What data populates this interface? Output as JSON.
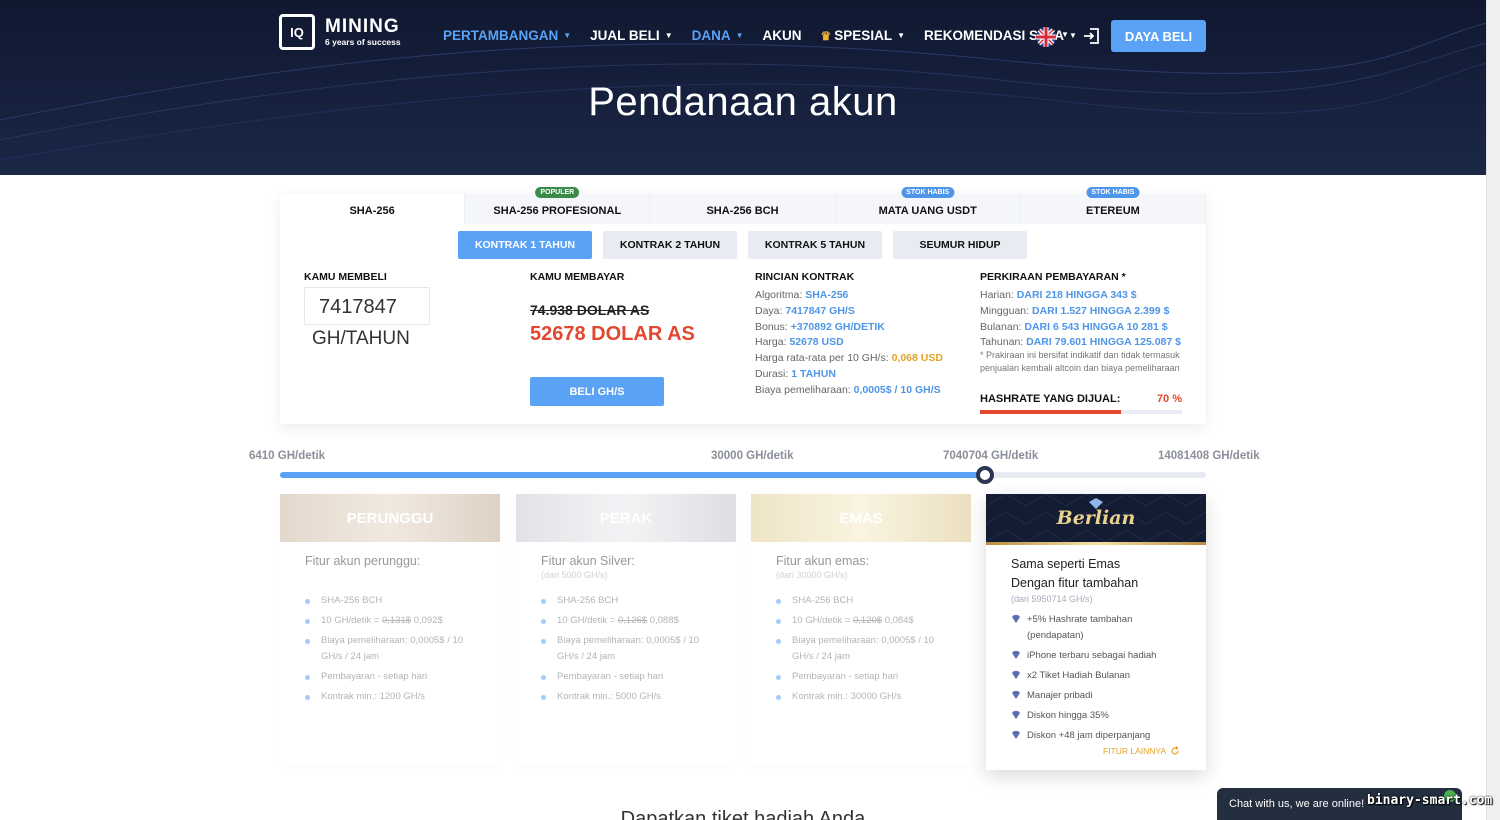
{
  "header": {
    "logo": {
      "mark": "IQ",
      "name": "MINING",
      "tagline": "6 years of success"
    },
    "nav": [
      {
        "label": "PERTAMBANGAN",
        "caret": true,
        "active": true
      },
      {
        "label": "JUAL BELI",
        "caret": true,
        "active": false
      },
      {
        "label": "DANA",
        "caret": true,
        "active": true
      },
      {
        "label": "AKUN",
        "caret": false,
        "active": false
      },
      {
        "label": "SPESIAL",
        "caret": true,
        "active": false
      },
      {
        "label": "REKOMENDASI SAYA",
        "caret": true,
        "active": false
      }
    ],
    "buy_label": "DAYA BELI"
  },
  "page_title": "Pendanaan akun",
  "algo_tabs": [
    {
      "label": "SHA-256",
      "badge": "",
      "active": true
    },
    {
      "label": "SHA-256 PROFESIONAL",
      "badge": "POPULER"
    },
    {
      "label": "SHA-256 BCH",
      "badge": ""
    },
    {
      "label": "MATA UANG USDT",
      "badge": "STOK HABIS"
    },
    {
      "label": "ETEREUM",
      "badge": "STOK HABIS"
    }
  ],
  "contract_tabs": [
    "KONTRAK 1 TAHUN",
    "KONTRAK 2 TAHUN",
    "KONTRAK 5 TAHUN",
    "SEUMUR HIDUP"
  ],
  "buy": {
    "title": "KAMU MEMBELI",
    "value": "7417847",
    "unit": "GH/TAHUN"
  },
  "pay": {
    "title": "KAMU MEMBAYAR",
    "old_price": "74.938 DOLAR AS",
    "new_price": "52678 DOLAR AS",
    "button": "BELI GH/S"
  },
  "details": {
    "title": "RINCIAN KONTRAK",
    "rows": [
      {
        "label": "Algoritma:",
        "value": "SHA-256"
      },
      {
        "label": "Daya:",
        "value": "7417847 GH/S"
      },
      {
        "label": "Bonus:",
        "value": "+370892 GH/DETIK"
      },
      {
        "label": "Harga:",
        "value": "52678 USD"
      },
      {
        "label": "Harga rata-rata per 10 GH/s:",
        "value": "0,068 USD"
      },
      {
        "label": "Durasi:",
        "value": "1 TAHUN"
      },
      {
        "label": "Biaya pemeliharaan:",
        "value": "0,0005$ / 10 GH/S"
      }
    ]
  },
  "payout": {
    "title": "PERKIRAAN PEMBAYARAN *",
    "rows": [
      {
        "label": "Harian:",
        "value": "DARI 218 HINGGA 343 $"
      },
      {
        "label": "Mingguan:",
        "value": "DARI 1.527 HINGGA 2.399 $"
      },
      {
        "label": "Bulanan:",
        "value": "DARI 6 543 HINGGA 10 281 $"
      },
      {
        "label": "Tahunan:",
        "value": "DARI 79.601 HINGGA 125.087 $"
      }
    ],
    "note": "* Prakiraan ini bersifat indikatif dan tidak termasuk penjualan kembali altcoin dan biaya pemeliharaan",
    "hashrate_label": "HASHRATE YANG DIJUAL:",
    "hashrate_value": "70 %",
    "hashrate_fraction": 0.7
  },
  "slider": {
    "labels": [
      "6410 GH/detik",
      "30000 GH/detik",
      "7040704 GH/detik",
      "14081408 GH/detik"
    ],
    "fraction": 0.761
  },
  "plans": [
    {
      "name": "PERUNGGU",
      "title": "Fitur akun perunggu:",
      "sub": "",
      "items": [
        "SHA-256 BCH",
        "10 GH/detik = ",
        "Biaya pemeliharaan: 0,0005$ / 10 GH/s / 24 jam",
        "Pembayaran - setiap hari",
        "Kontrak min.: 1200 GH/s"
      ],
      "old": "0,131$",
      "new": " 0,092$"
    },
    {
      "name": "PERAK",
      "title": "Fitur akun Silver:",
      "sub": "(dari 5000 GH/s)",
      "items": [
        "SHA-256 BCH",
        "10 GH/detik = ",
        "Biaya pemeliharaan: 0,0005$ / 10 GH/s / 24 jam",
        "Pembayaran - setiap hari",
        "Kontrak min.: 5000 GH/s"
      ],
      "old": "0,126$",
      "new": " 0,088$"
    },
    {
      "name": "EMAS",
      "title": "Fitur akun emas:",
      "sub": "(dari 30000 GH/s)",
      "items": [
        "SHA-256 BCH",
        "10 GH/detik = ",
        "Biaya pemeliharaan: 0,0005$ / 10 GH/s / 24 jam",
        "Pembayaran - setiap hari",
        "Kontrak min.: 30000 GH/s"
      ],
      "old": "0,120$",
      "new": " 0,084$"
    }
  ],
  "diamond": {
    "name": "Berlian",
    "title1": "Sama seperti Emas",
    "title2": "Dengan fitur tambahan",
    "sub": "(dari 5950714 GH/s)",
    "items": [
      "+5% Hashrate tambahan (pendapatan)",
      "iPhone terbaru sebagai hadiah",
      "x2 Tiket Hadiah Bulanan",
      "Manajer pribadi",
      "Diskon hingga 35%",
      "Diskon +48 jam diperpanjang"
    ],
    "more": "FITUR LAINNYA"
  },
  "bottom_peek": "Dapatkan tiket hadiah Anda",
  "chat": "Chat with us, we are online!",
  "watermark": "binary-smart.com",
  "colors": {
    "accent": "#5aa2f5",
    "price_red": "#e2472f",
    "gold": "#e5a228",
    "header_bg": "#16213e"
  }
}
